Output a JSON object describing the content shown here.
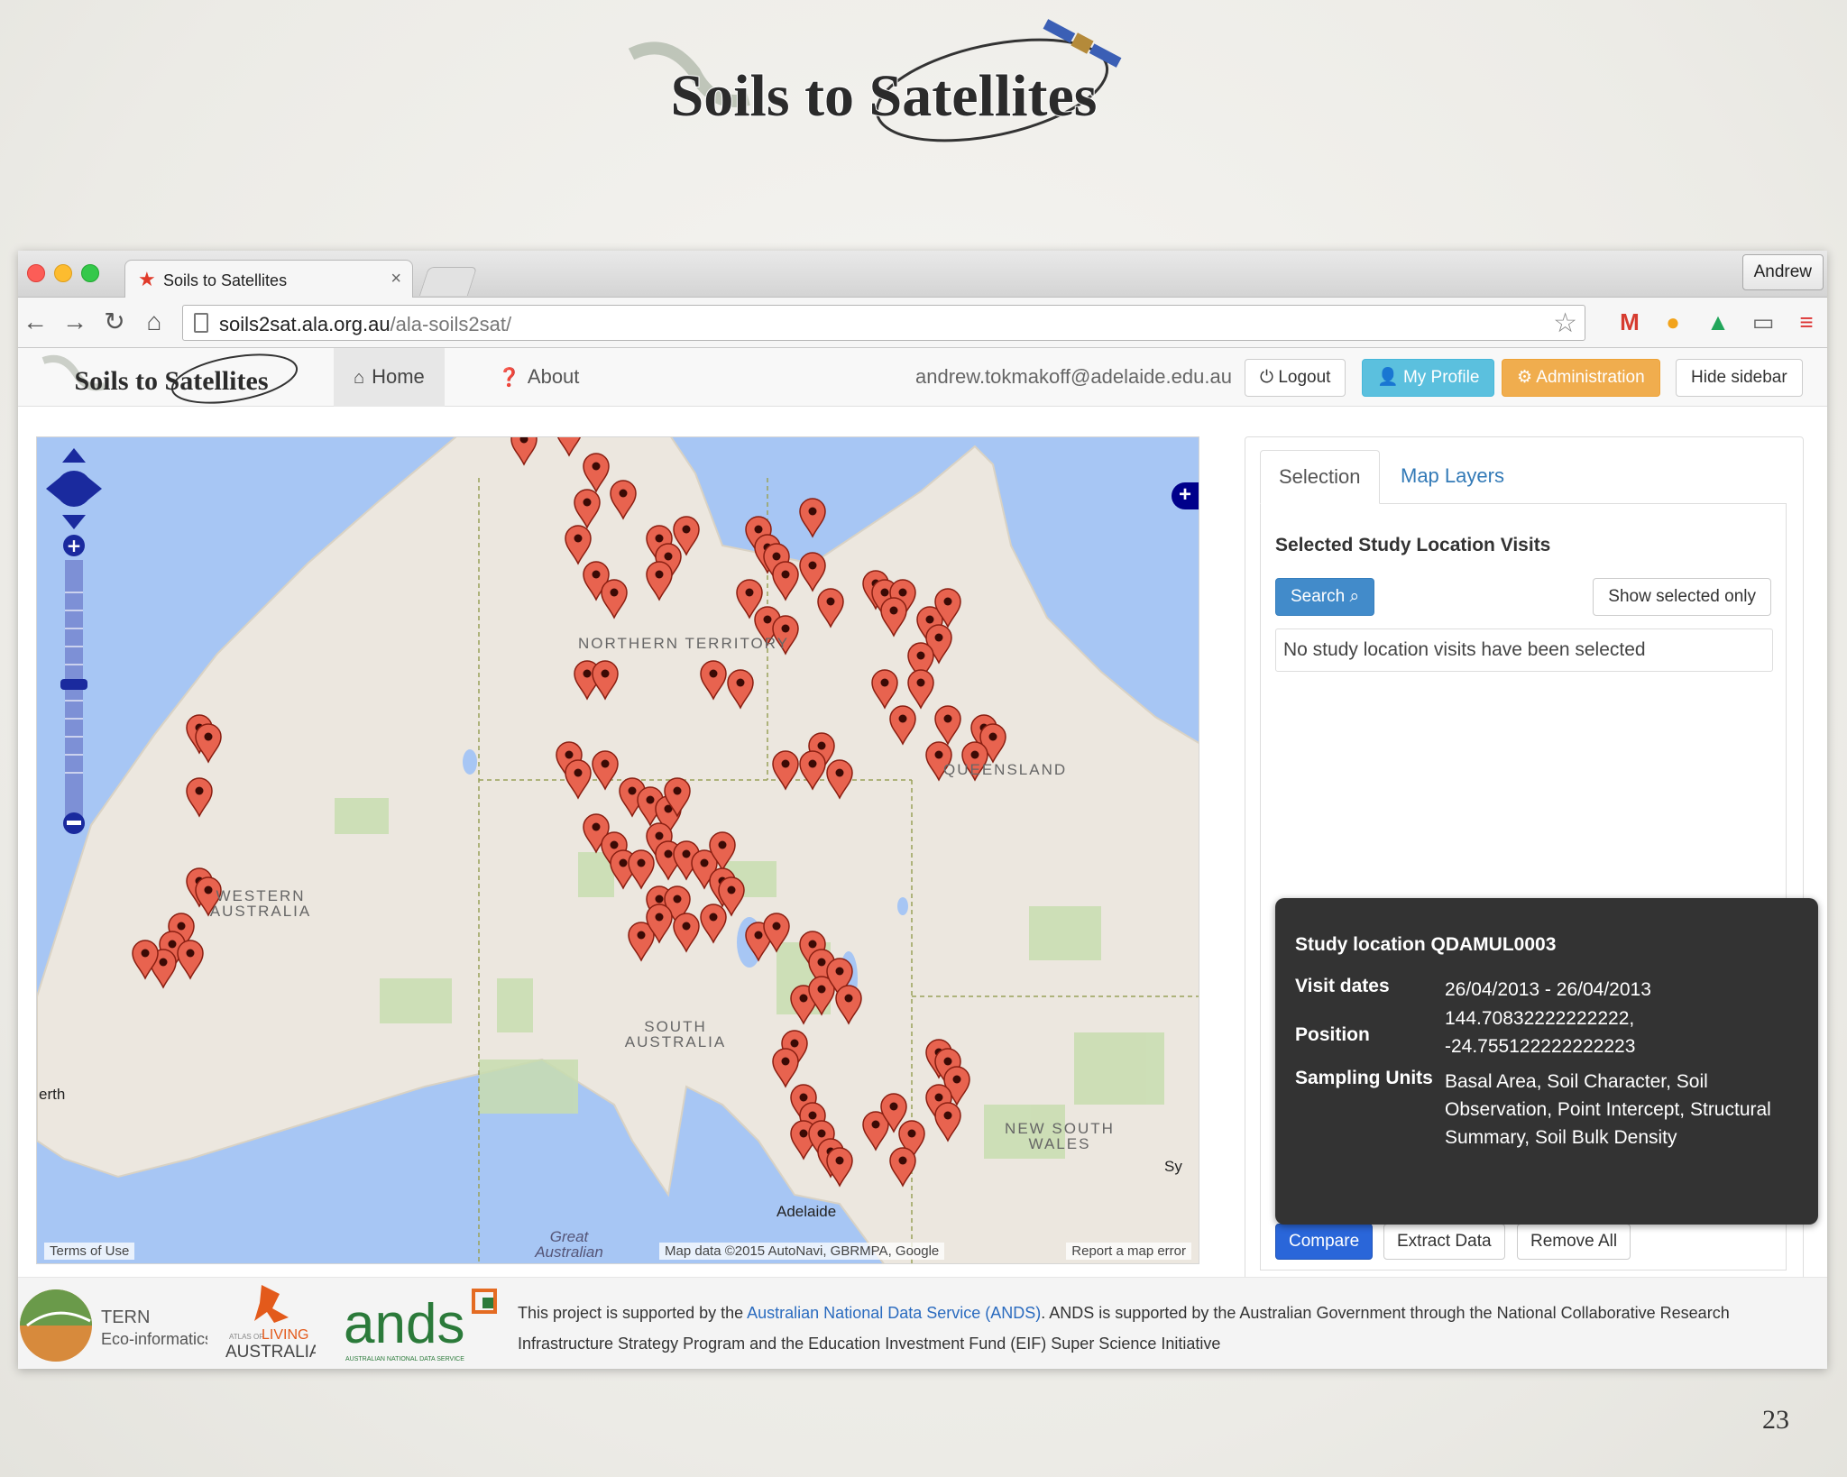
{
  "slide": {
    "logo_text": "Soils to Satellites",
    "page_number": "23"
  },
  "browser": {
    "tab_title": "Soils to Satellites",
    "tab_close": "×",
    "profile_name": "Andrew",
    "url_host": "soils2sat.ala.org.au",
    "url_path": "/ala-soils2sat/",
    "icons": [
      "back-arrow-icon",
      "forward-arrow-icon",
      "reload-icon",
      "home-icon",
      "page-icon",
      "star-icon",
      "gmail-icon",
      "user-icon",
      "drive-icon",
      "cast-icon",
      "menu-icon"
    ]
  },
  "app": {
    "brand": "Soils to Satellites",
    "nav": {
      "home": "Home",
      "about": "About"
    },
    "user_email": "andrew.tokmakoff@adelaide.edu.au",
    "buttons": {
      "logout": "Logout",
      "my_profile": "My Profile",
      "administration": "Administration",
      "hide_sidebar": "Hide sidebar"
    },
    "colors": {
      "info": "#5bc0de",
      "warning": "#f0ad4e",
      "primary": "#428bca",
      "marker": "#e8634f"
    }
  },
  "map": {
    "labels": {
      "northern_territory": "NORTHERN TERRITORY",
      "queensland": "QUEENSLAND",
      "western_australia": "WESTERN AUSTRALIA",
      "south_australia": "SOUTH AUSTRALIA",
      "new_south_wales": "NEW SOUTH WALES",
      "perth": "erth",
      "adelaide": "Adelaide",
      "great_australian": "Great Australian",
      "sydney": "Sy"
    },
    "terms": "Terms of Use",
    "attribution": "Map data ©2015 AutoNavi, GBRMPA, Google",
    "report": "Report a map error"
  },
  "sidebar": {
    "tabs": {
      "selection": "Selection",
      "map_layers": "Map Layers"
    },
    "heading": "Selected Study Location Visits",
    "search_button": "Search",
    "show_selected_button": "Show selected only",
    "empty_message": "No study location visits have been selected",
    "compare_button": "Compare",
    "extract_button": "Extract Data",
    "remove_button": "Remove All"
  },
  "tooltip": {
    "title": "Study location QDAMUL0003",
    "visit_dates_label": "Visit dates",
    "visit_dates": "26/04/2013 - 26/04/2013",
    "position_label": "Position",
    "position_line1": "144.70832222222222,",
    "position_line2": "-24.755122222222223",
    "sampling_units_label": "Sampling Units",
    "sampling_units": "Basal Area, Soil Character, Soil Observation, Point Intercept, Structural Summary, Soil Bulk Density"
  },
  "footer": {
    "tern_name": "TERN",
    "tern_sub": "Eco-informatics",
    "ala_small": "ATLAS OF",
    "ala_living": "LIVING",
    "ala_australia": "AUSTRALIA",
    "ands_name": "ands",
    "ands_sub": "AUSTRALIAN NATIONAL DATA SERVICE",
    "text_before": "This project is supported by the ",
    "ands_link": "Australian National Data Service (ANDS)",
    "text_after": ". ANDS is supported by the Australian Government through the National Collaborative Research Infrastructure Strategy Program and the Education Investment Fund (EIF) Super Science Initiative"
  }
}
